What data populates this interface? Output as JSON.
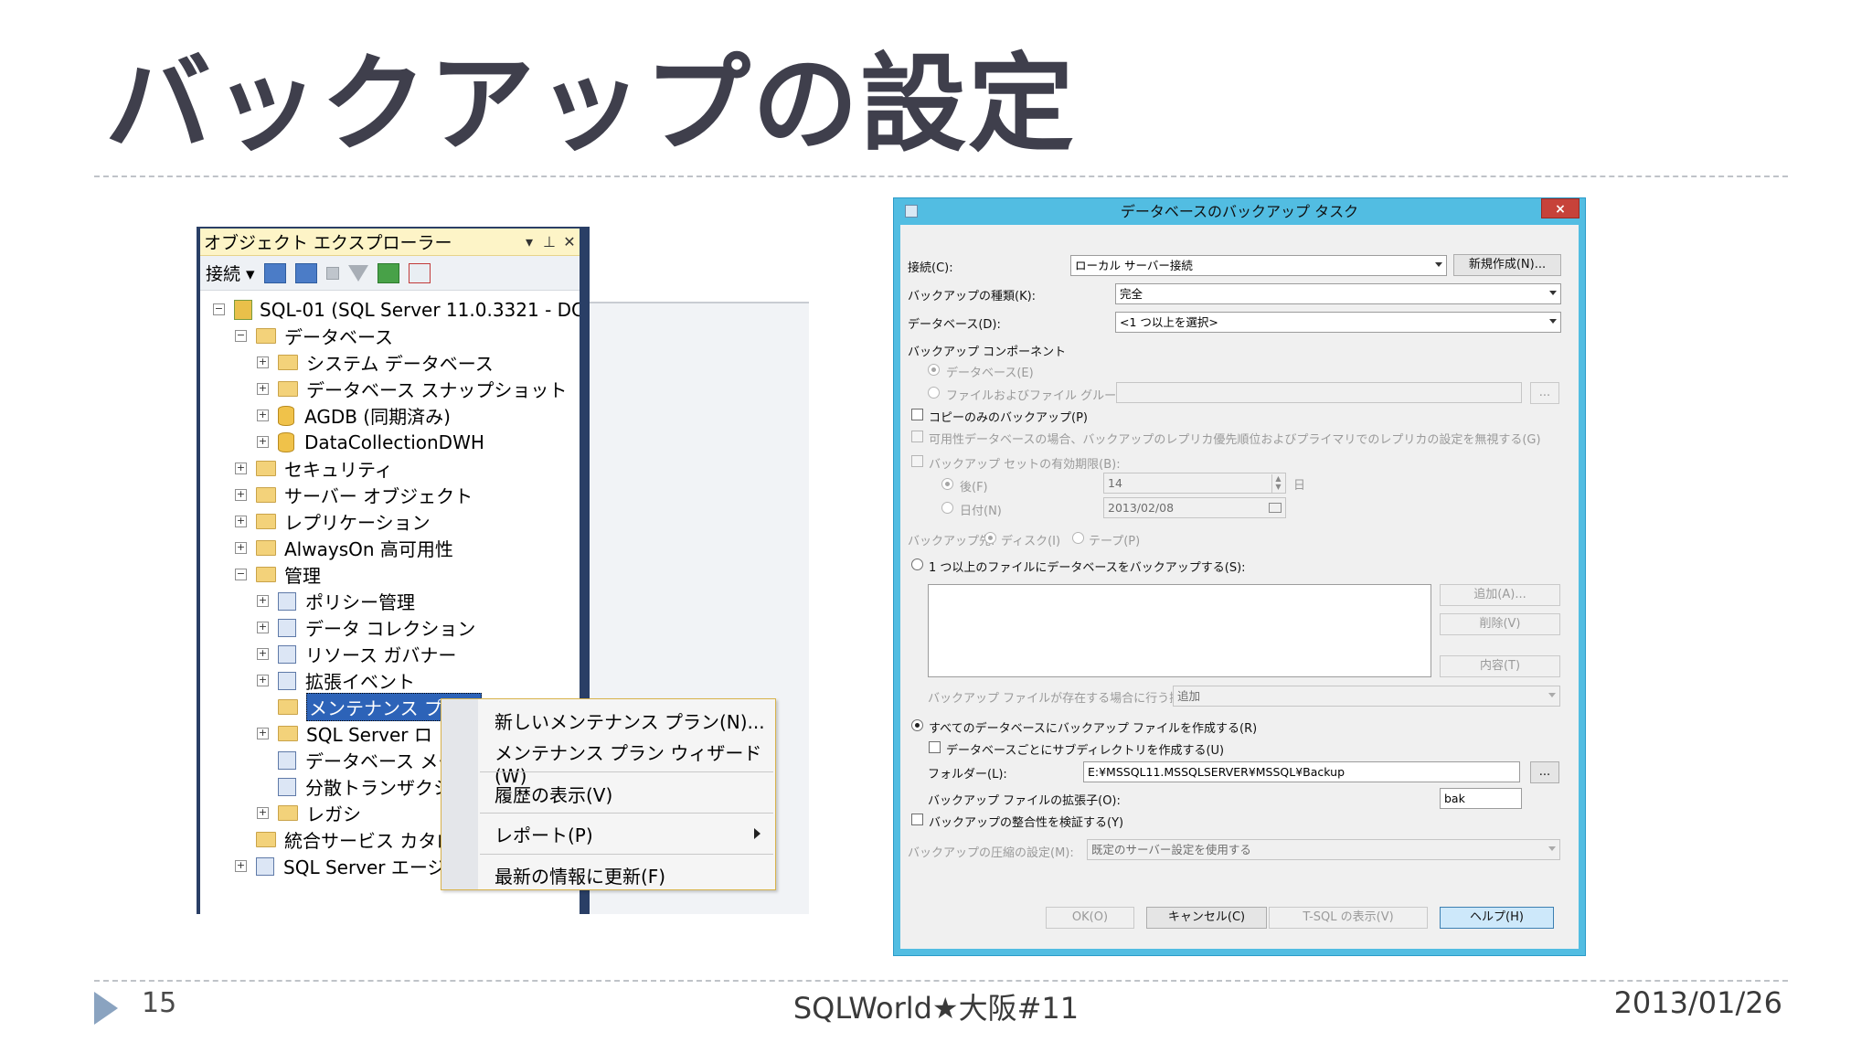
{
  "slide": {
    "title": "バックアップの設定",
    "page_number": "15",
    "event": "SQLWorld★大阪#11",
    "date": "2013/01/26"
  },
  "object_explorer": {
    "title": "オブジェクト エクスプローラー",
    "title_controls": [
      "▾",
      "⊥",
      "✕"
    ],
    "connect_label": "接続 ▾",
    "tree": {
      "server": "SQL-01 (SQL Server 11.0.3321 - DC",
      "databases": "データベース",
      "system_db": "システム データベース",
      "snapshot": "データベース スナップショット",
      "agdb": "AGDB (同期済み)",
      "dwh": "DataCollectionDWH",
      "security": "セキュリティ",
      "server_objects": "サーバー オブジェクト",
      "replication": "レプリケーション",
      "alwayson": "AlwaysOn 高可用性",
      "management": "管理",
      "policy": "ポリシー管理",
      "data_collection": "データ コレクション",
      "resource_governor": "リソース ガバナー",
      "extended_events": "拡張イベント",
      "maintenance_plans": "メンテナンス プラン",
      "sql_server_logs": "SQL Server ロ",
      "db_mail": "データベース メー",
      "dtc": "分散トランザクシ",
      "legacy": "レガシ",
      "integration_catalog": "統合サービス カタログ",
      "agent": "SQL Server エージ"
    }
  },
  "context_menu": {
    "new_plan": "新しいメンテナンス プラン(N)...",
    "wizard": "メンテナンス プラン ウィザード(W)",
    "history": "履歴の表示(V)",
    "reports": "レポート(P)",
    "refresh": "最新の情報に更新(F)"
  },
  "dialog": {
    "title": "データベースのバックアップ タスク",
    "close": "×",
    "connection_label": "接続(C):",
    "connection_value": "ローカル サーバー接続",
    "new_button": "新規作成(N)...",
    "backup_type_label": "バックアップの種類(K):",
    "backup_type_value": "完全",
    "database_label": "データベース(D):",
    "database_value": "<1 つ以上を選択>",
    "component_label": "バックアップ コンポーネント",
    "component_database": "データベース(E)",
    "component_files": "ファイルおよびファイル グループ(G):",
    "browse": "...",
    "copy_only": "コピーのみのバックアップ(P)",
    "ignore_replica": "可用性データベースの場合、バックアップのレプリカ優先順位およびプライマリでのレプリカの設定を無視する(G)",
    "expire_label": "バックアップ セットの有効期限(B):",
    "after_label": "後(F)",
    "after_value": "14",
    "days_unit": "日",
    "on_label": "日付(N)",
    "on_value": "2013/02/08",
    "dest_label": "バックアップ先:",
    "dest_disk": "ディスク(I)",
    "dest_tape": "テープ(P)",
    "across_files": "1 つ以上のファイルにデータベースをバックアップする(S):",
    "add_button": "追加(A)...",
    "remove_button": "削除(V)",
    "contents_button": "内容(T)",
    "if_exists_label": "バックアップ ファイルが存在する場合に行う操作(X):",
    "if_exists_value": "追加",
    "per_db_files": "すべてのデータベースにバックアップ ファイルを作成する(R)",
    "subdir": "データベースごとにサブディレクトリを作成する(U)",
    "folder_label": "フォルダー(L):",
    "folder_value": "E:¥MSSQL11.MSSQLSERVER¥MSSQL¥Backup",
    "ext_label": "バックアップ ファイルの拡張子(O):",
    "ext_value": "bak",
    "verify": "バックアップの整合性を検証する(Y)",
    "compression_label": "バックアップの圧縮の設定(M):",
    "compression_value": "既定のサーバー設定を使用する",
    "ok": "OK(O)",
    "cancel": "キャンセル(C)",
    "tsql": "T-SQL の表示(V)",
    "help": "ヘルプ(H)"
  }
}
